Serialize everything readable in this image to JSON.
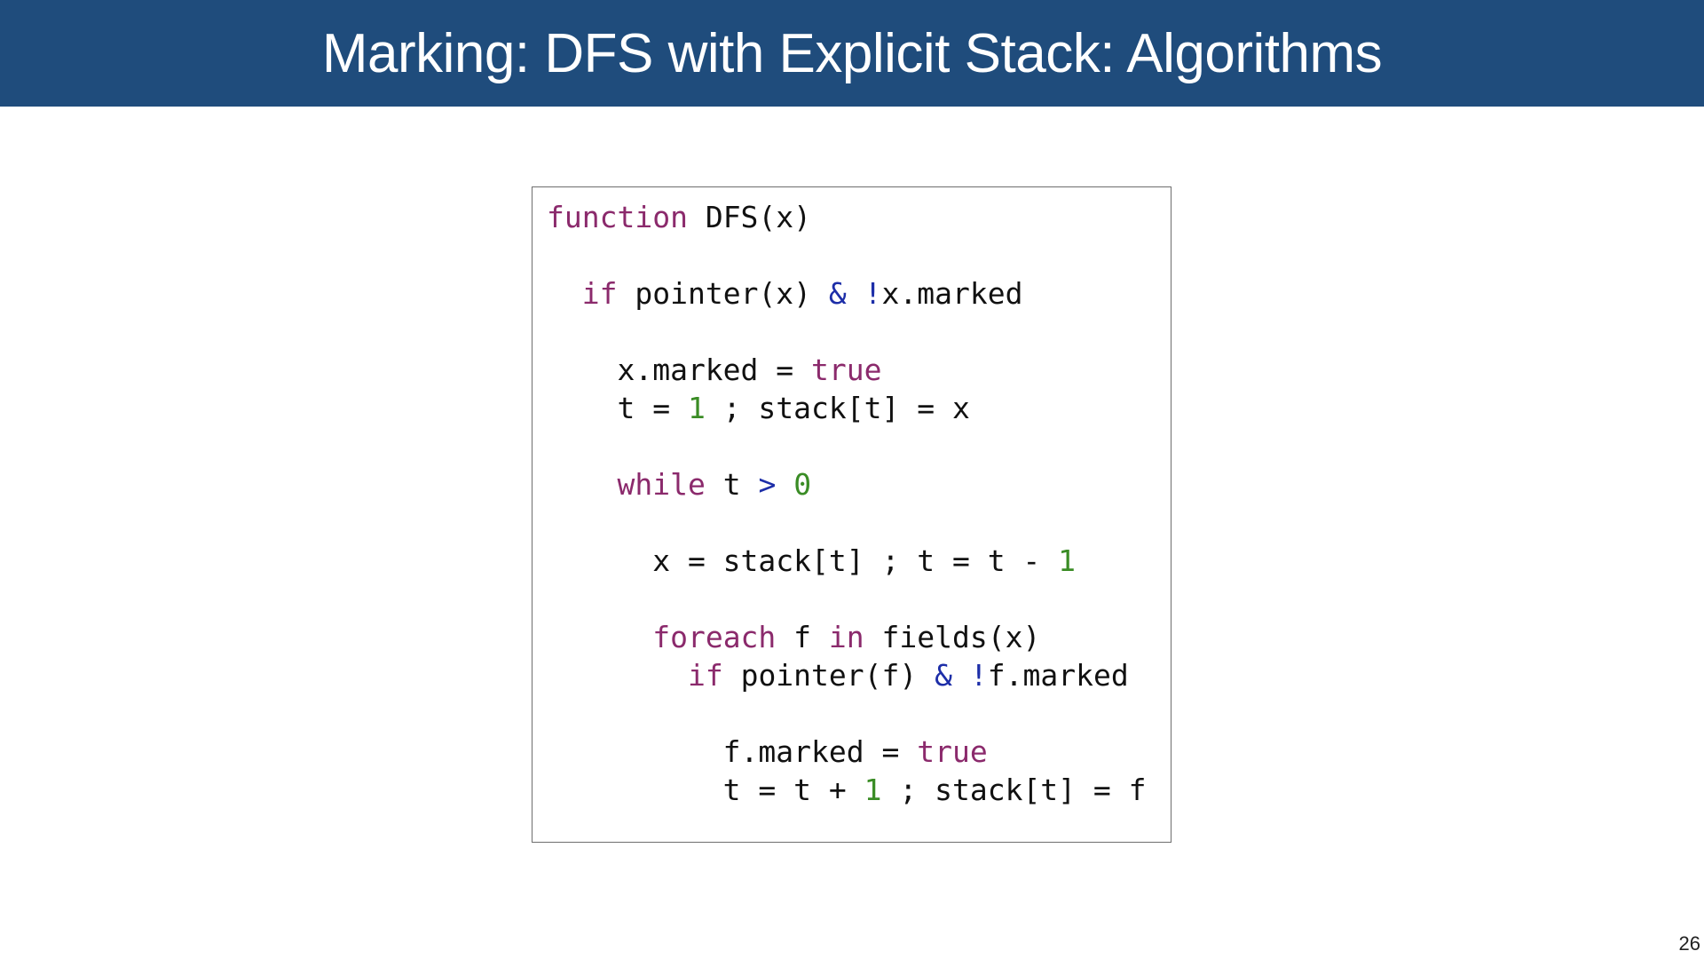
{
  "slide": {
    "title": "Marking: DFS with Explicit Stack: Algorithms",
    "page_number": "26"
  },
  "colors": {
    "title_bar": "#1f4c7c",
    "keyword": "#8b2a6c",
    "operator": "#1d2ea8",
    "number": "#3a8c25",
    "text": "#111111"
  },
  "code": {
    "lines": [
      [
        {
          "t": "function",
          "c": "kw"
        },
        {
          "t": " DFS(x)",
          "c": "txt"
        }
      ],
      [],
      [
        {
          "t": "  ",
          "c": "txt"
        },
        {
          "t": "if",
          "c": "kw"
        },
        {
          "t": " pointer(x) ",
          "c": "txt"
        },
        {
          "t": "&",
          "c": "op"
        },
        {
          "t": " ",
          "c": "txt"
        },
        {
          "t": "!",
          "c": "op"
        },
        {
          "t": "x.marked",
          "c": "txt"
        }
      ],
      [],
      [
        {
          "t": "    x.marked = ",
          "c": "txt"
        },
        {
          "t": "true",
          "c": "kw"
        }
      ],
      [
        {
          "t": "    t = ",
          "c": "txt"
        },
        {
          "t": "1",
          "c": "num"
        },
        {
          "t": " ; stack[t] = x",
          "c": "txt"
        }
      ],
      [],
      [
        {
          "t": "    ",
          "c": "txt"
        },
        {
          "t": "while",
          "c": "kw"
        },
        {
          "t": " t ",
          "c": "txt"
        },
        {
          "t": ">",
          "c": "op"
        },
        {
          "t": " ",
          "c": "txt"
        },
        {
          "t": "0",
          "c": "num"
        }
      ],
      [],
      [
        {
          "t": "      x = stack[t] ; t = t - ",
          "c": "txt"
        },
        {
          "t": "1",
          "c": "num"
        }
      ],
      [],
      [
        {
          "t": "      ",
          "c": "txt"
        },
        {
          "t": "foreach",
          "c": "kw"
        },
        {
          "t": " f ",
          "c": "txt"
        },
        {
          "t": "in",
          "c": "kw"
        },
        {
          "t": " fields(x)",
          "c": "txt"
        }
      ],
      [
        {
          "t": "        ",
          "c": "txt"
        },
        {
          "t": "if",
          "c": "kw"
        },
        {
          "t": " pointer(f) ",
          "c": "txt"
        },
        {
          "t": "&",
          "c": "op"
        },
        {
          "t": " ",
          "c": "txt"
        },
        {
          "t": "!",
          "c": "op"
        },
        {
          "t": "f.marked",
          "c": "txt"
        }
      ],
      [],
      [
        {
          "t": "          f.marked = ",
          "c": "txt"
        },
        {
          "t": "true",
          "c": "kw"
        }
      ],
      [
        {
          "t": "          t = t + ",
          "c": "txt"
        },
        {
          "t": "1",
          "c": "num"
        },
        {
          "t": " ; stack[t] = f",
          "c": "txt"
        }
      ]
    ]
  }
}
